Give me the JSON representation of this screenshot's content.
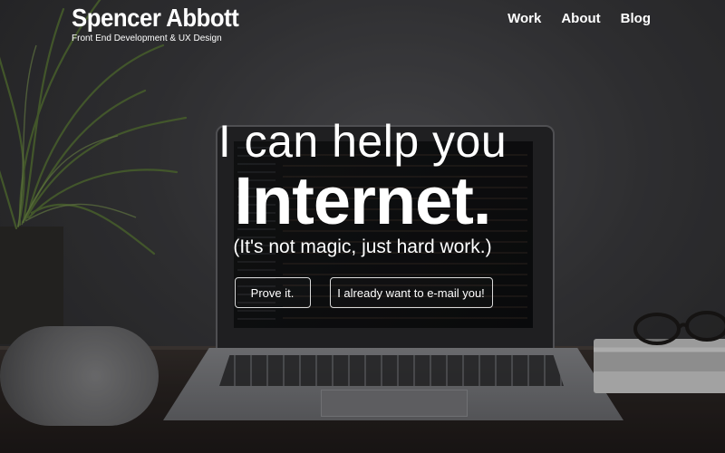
{
  "header": {
    "brand_name": "Spencer Abbott",
    "brand_tagline": "Front End Development & UX Design",
    "nav": [
      {
        "label": "Work"
      },
      {
        "label": "About"
      },
      {
        "label": "Blog"
      }
    ]
  },
  "hero": {
    "line1": "I can help you",
    "line2": "Internet.",
    "subtitle": "(It's not magic, just hard work.)",
    "primary_button": "Prove it.",
    "secondary_button": "I already want to e-mail you!"
  },
  "colors": {
    "text": "#ffffff",
    "button_border": "#d9d9d9",
    "background": "#3a3a3c"
  }
}
